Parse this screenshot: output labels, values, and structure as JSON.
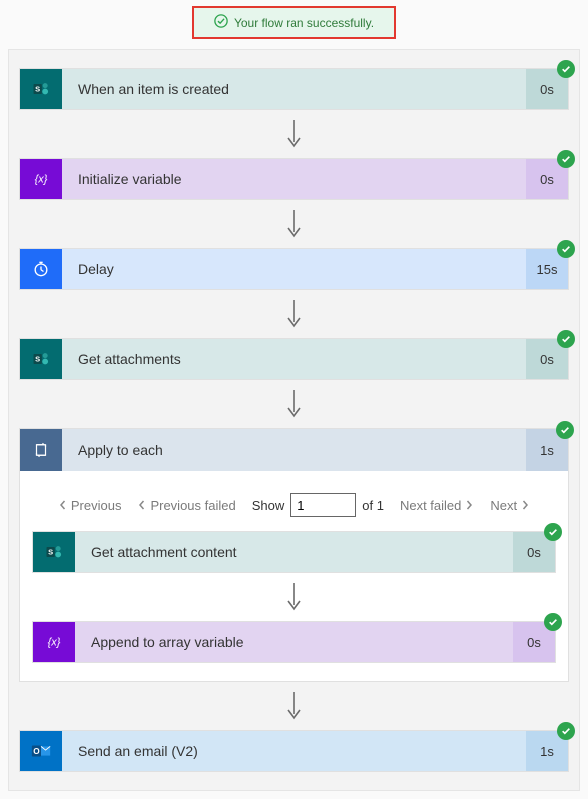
{
  "banner": {
    "text": "Your flow ran successfully."
  },
  "steps": {
    "trigger": {
      "label": "When an item is created",
      "duration": "0s"
    },
    "initvar": {
      "label": "Initialize variable",
      "duration": "0s"
    },
    "delay": {
      "label": "Delay",
      "duration": "15s"
    },
    "getatt": {
      "label": "Get attachments",
      "duration": "0s"
    },
    "each": {
      "label": "Apply to each",
      "duration": "1s",
      "pager": {
        "prev": "Previous",
        "prev_failed": "Previous failed",
        "show": "Show",
        "value": "1",
        "of": "of 1",
        "next_failed": "Next failed",
        "next": "Next"
      },
      "children": {
        "getcontent": {
          "label": "Get attachment content",
          "duration": "0s"
        },
        "append": {
          "label": "Append to array variable",
          "duration": "0s"
        }
      }
    },
    "mail": {
      "label": "Send an email (V2)",
      "duration": "1s"
    }
  }
}
